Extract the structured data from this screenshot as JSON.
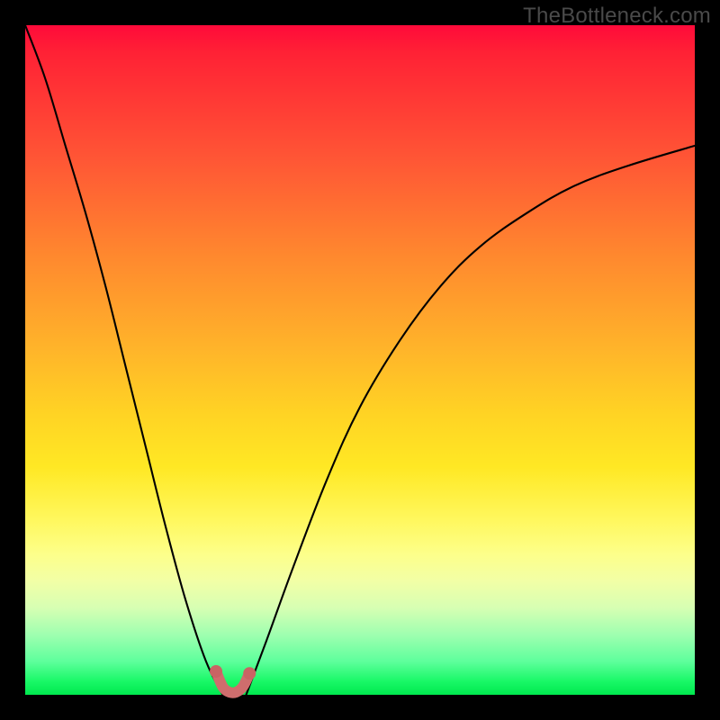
{
  "watermark": "TheBottleneck.com",
  "colors": {
    "gradient_top": "#ff0a3a",
    "gradient_mid": "#ffd324",
    "gradient_bottom": "#00e84e",
    "curve": "#000000",
    "hump": "#cf6d6d",
    "frame": "#000000"
  },
  "chart_data": {
    "type": "line",
    "title": "",
    "xlabel": "",
    "ylabel": "",
    "xlim": [
      0,
      100
    ],
    "ylim": [
      0,
      100
    ],
    "grid": false,
    "legend": false,
    "annotations": [
      "TheBottleneck.com"
    ],
    "series": [
      {
        "name": "left-branch",
        "x": [
          0,
          3,
          6,
          9,
          12,
          15,
          18,
          21,
          24,
          27,
          29.5
        ],
        "y": [
          100,
          92,
          82,
          72,
          61,
          49,
          37,
          25,
          14,
          5,
          0
        ]
      },
      {
        "name": "right-branch",
        "x": [
          33,
          36,
          40,
          45,
          50,
          56,
          62,
          68,
          75,
          82,
          90,
          100
        ],
        "y": [
          0,
          8,
          19,
          32,
          43,
          53,
          61,
          67,
          72,
          76,
          79,
          82
        ]
      },
      {
        "name": "minimum-hump",
        "x": [
          28.5,
          29.5,
          30.5,
          31.5,
          32.5,
          33.5
        ],
        "y": [
          3.5,
          1.2,
          0.4,
          0.4,
          1.2,
          3.2
        ]
      }
    ]
  }
}
